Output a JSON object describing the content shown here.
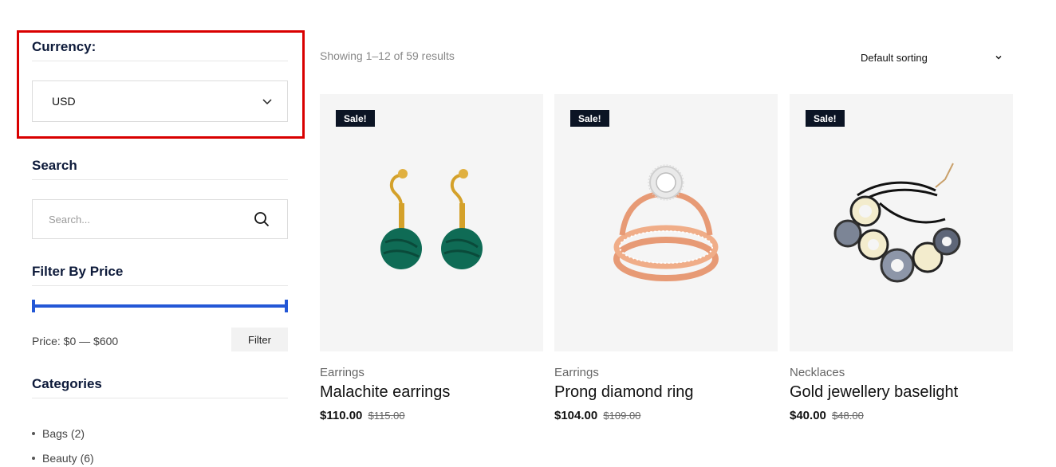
{
  "sidebar": {
    "currency": {
      "title": "Currency:",
      "selected": "USD"
    },
    "search": {
      "title": "Search",
      "placeholder": "Search..."
    },
    "price_filter": {
      "title": "Filter By Price",
      "price_label": "Price: $0 — $600",
      "range_min": 0,
      "range_max": 600,
      "filter_button": "Filter",
      "accent_color": "#2357d6"
    },
    "categories": {
      "title": "Categories",
      "items": [
        {
          "label": "Bags",
          "count": "(2)"
        },
        {
          "label": "Beauty",
          "count": "(6)"
        }
      ]
    },
    "highlight_color": "#d90000"
  },
  "main": {
    "result_count": "Showing 1–12 of 59 results",
    "sorting": {
      "selected": "Default sorting"
    },
    "products": [
      {
        "badge": "Sale!",
        "category": "Earrings",
        "name": "Malachite earrings",
        "price": "$110.00",
        "old_price": "$115.00",
        "image": "malachite-earrings-image"
      },
      {
        "badge": "Sale!",
        "category": "Earrings",
        "name": "Prong diamond ring",
        "price": "$104.00",
        "old_price": "$109.00",
        "image": "diamond-ring-image"
      },
      {
        "badge": "Sale!",
        "category": "Necklaces",
        "name": "Gold jewellery baselight",
        "price": "$40.00",
        "old_price": "$48.00",
        "image": "bracelet-image"
      }
    ]
  }
}
